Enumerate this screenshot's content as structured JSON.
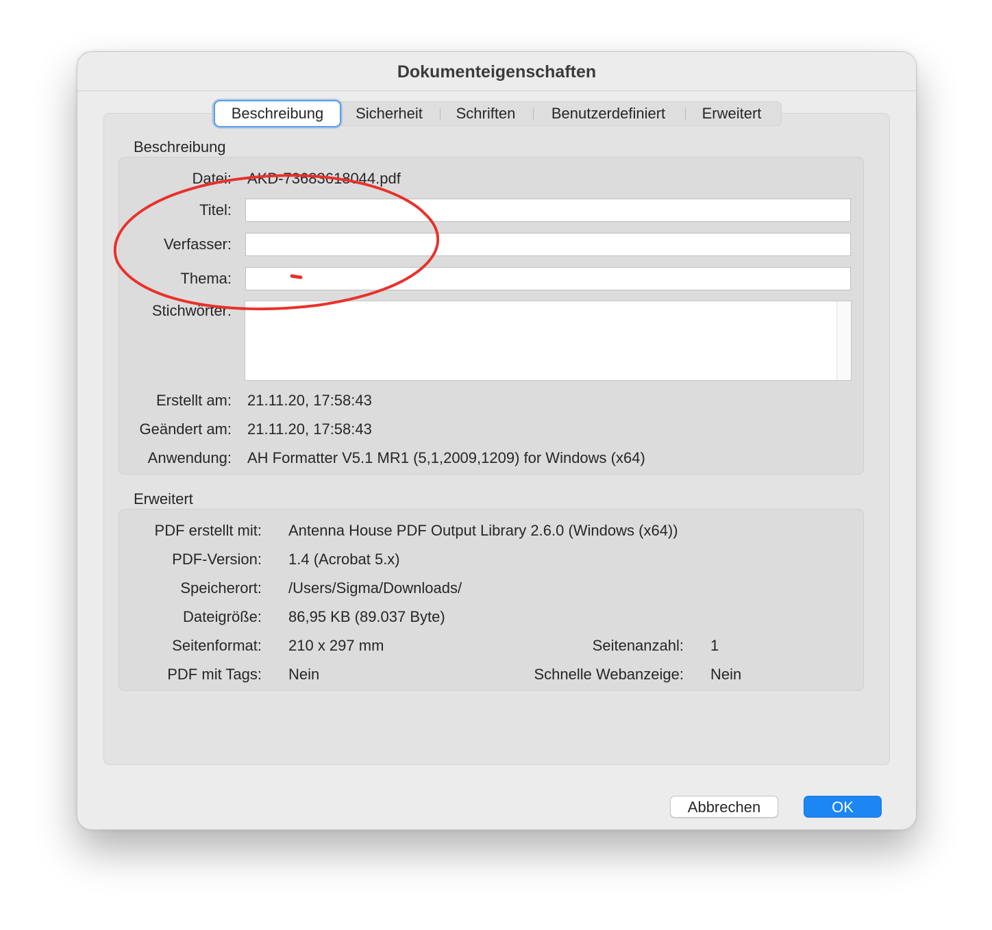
{
  "dialog": {
    "title": "Dokumenteigenschaften"
  },
  "tabs": [
    {
      "label": "Beschreibung",
      "active": true
    },
    {
      "label": "Sicherheit",
      "active": false
    },
    {
      "label": "Schriften",
      "active": false
    },
    {
      "label": "Benutzerdefiniert",
      "active": false
    },
    {
      "label": "Erweitert",
      "active": false
    }
  ],
  "description": {
    "heading": "Beschreibung",
    "file_label": "Datei:",
    "file_value": "AKD-73683618044.pdf",
    "title_label": "Titel:",
    "title_value": "",
    "author_label": "Verfasser:",
    "author_value": "",
    "subject_label": "Thema:",
    "subject_value": "",
    "keywords_label": "Stichwörter:",
    "keywords_value": "",
    "created_label": "Erstellt am:",
    "created_value": "21.11.20, 17:58:43",
    "modified_label": "Geändert am:",
    "modified_value": "21.11.20, 17:58:43",
    "application_label": "Anwendung:",
    "application_value": "AH Formatter V5.1 MR1 (5,1,2009,1209) for Windows (x64)"
  },
  "advanced": {
    "heading": "Erweitert",
    "producer_label": "PDF erstellt mit:",
    "producer_value": "Antenna House PDF Output Library 2.6.0 (Windows (x64))",
    "version_label": "PDF-Version:",
    "version_value": "1.4 (Acrobat 5.x)",
    "location_label": "Speicherort:",
    "location_value": "/Users/Sigma/Downloads/",
    "filesize_label": "Dateigröße:",
    "filesize_value": "86,95 KB (89.037 Byte)",
    "pagesize_label": "Seitenformat:",
    "pagesize_value": "210 x 297 mm",
    "pagecount_label": "Seitenanzahl:",
    "pagecount_value": "1",
    "tagged_label": "PDF mit Tags:",
    "tagged_value": "Nein",
    "fastweb_label": "Schnelle Webanzeige:",
    "fastweb_value": "Nein"
  },
  "buttons": {
    "cancel": "Abbrechen",
    "ok": "OK"
  },
  "colors": {
    "annotation": "#e8322b",
    "accent": "#1c86f2"
  }
}
